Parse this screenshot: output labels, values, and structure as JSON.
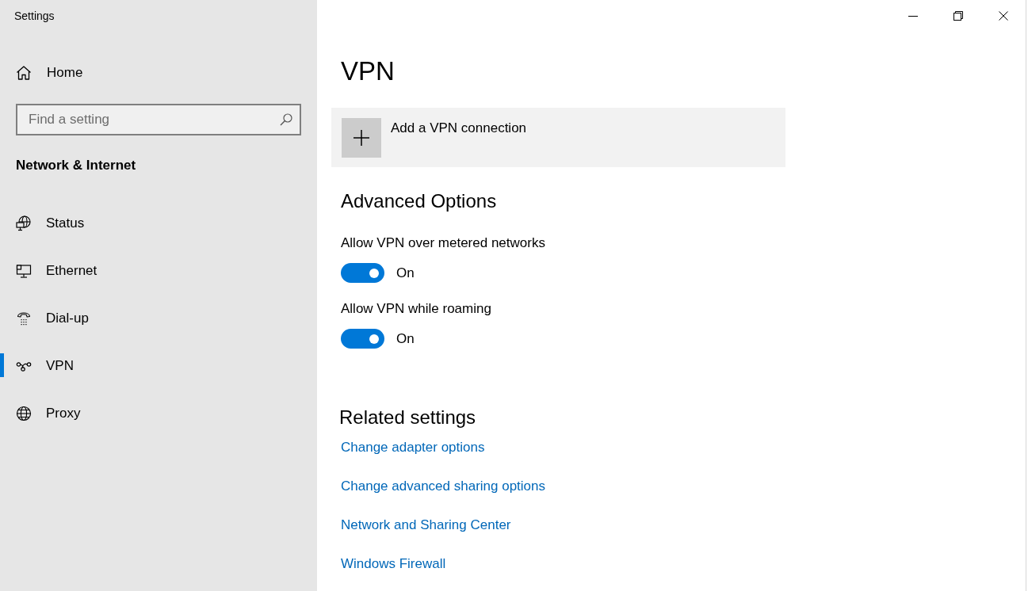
{
  "window": {
    "title": "Settings"
  },
  "sidebar": {
    "home": "Home",
    "search": {
      "placeholder": "Find a setting"
    },
    "section": "Network & Internet",
    "items": [
      {
        "label": "Status",
        "selected": false
      },
      {
        "label": "Ethernet",
        "selected": false
      },
      {
        "label": "Dial-up",
        "selected": false
      },
      {
        "label": "VPN",
        "selected": true
      },
      {
        "label": "Proxy",
        "selected": false
      }
    ]
  },
  "page": {
    "title": "VPN",
    "add_button": "Add a VPN connection",
    "advanced_options": {
      "heading": "Advanced Options",
      "options": [
        {
          "label": "Allow VPN over metered networks",
          "on": true,
          "state_text": "On"
        },
        {
          "label": "Allow VPN while roaming",
          "on": true,
          "state_text": "On"
        }
      ]
    },
    "related_settings": {
      "heading": "Related settings",
      "links": [
        "Change adapter options",
        "Change advanced sharing options",
        "Network and Sharing Center",
        "Windows Firewall"
      ]
    }
  }
}
